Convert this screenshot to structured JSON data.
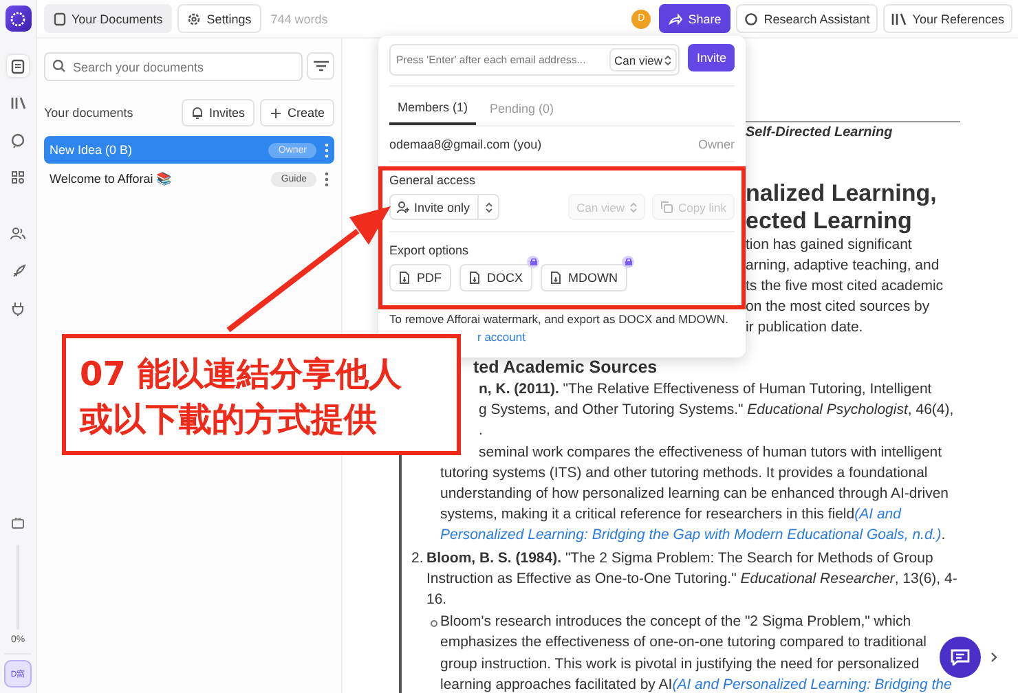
{
  "top_bar": {
    "tabs": [
      {
        "label": "Your Documents",
        "selected": true
      },
      {
        "label": "Settings",
        "selected": false
      }
    ],
    "word_count": "744 words",
    "avatar": "D",
    "share_button": "Share",
    "buttons": [
      "Research Assistant",
      "Your References"
    ]
  },
  "rail": {
    "zoom": {
      "level": 0,
      "reading": "0%"
    },
    "user_badge": "D窩"
  },
  "sidebar": {
    "search": {
      "placeholder": "Search your documents"
    },
    "heading": "Your documents",
    "invites_button": "Invites",
    "create_button": "Create",
    "documents": [
      {
        "title": "New Idea (0 B)",
        "badge": "Owner",
        "selected": true
      },
      {
        "title": "Welcome to Afforai 📚",
        "badge": "Guide",
        "selected": false
      }
    ]
  },
  "share_popup": {
    "email_field": {
      "placeholder": "Press 'Enter' after each email address..."
    },
    "role_select": "Can view",
    "invite_button": "Invite",
    "tabs": [
      {
        "label": "Members (1)",
        "selected": true
      },
      {
        "label": "Pending (0)",
        "selected": false
      }
    ],
    "members": [
      {
        "email": "odemaa8@gmail.com (you)",
        "role": "Owner"
      }
    ],
    "general_access": {
      "label": "General access",
      "access_select": "Invite only",
      "link_role": {
        "label": "Can view",
        "disabled": true
      },
      "copy_link": {
        "label": "Copy link",
        "disabled": true
      }
    },
    "export": {
      "label": "Export options",
      "buttons": [
        {
          "label": "PDF",
          "locked": false
        },
        {
          "label": "DOCX",
          "locked": true
        },
        {
          "label": "MDOWN",
          "locked": true
        }
      ]
    },
    "note": "To remove Afforai watermark, and export as DOCX and MDOWN.",
    "upgrade_link": "r account"
  },
  "document": {
    "top_lines": [
      {
        "kind": "subtitle",
        "text": "Self-Directed Learning"
      },
      {
        "kind": "heading",
        "text": "nalized Learning,"
      },
      {
        "kind": "heading",
        "text": "ected Learning"
      },
      {
        "kind": "body",
        "text": "tion has gained significant"
      },
      {
        "kind": "body",
        "text": "arning, adaptive teaching, and"
      },
      {
        "kind": "body",
        "text": "ts the five most cited academic"
      },
      {
        "kind": "body",
        "text": "on the most cited sources by"
      },
      {
        "kind": "body",
        "text": "ir publication date."
      }
    ],
    "lines": [
      {
        "kind": "heading",
        "parts": [
          {
            "kind": "text",
            "text": "ted Academic Sources"
          }
        ]
      },
      {
        "kind": "cut",
        "parts": [
          {
            "kind": "text",
            "text": "**n, K. (2011).** \"The Relative Effectiveness of Human Tutoring, Intelligent"
          }
        ]
      },
      {
        "kind": "cut",
        "parts": [
          {
            "kind": "text",
            "text": "g Systems, and Other Tutoring Systems.\" *Educational Psychologist*, 46(4),"
          }
        ]
      },
      {
        "kind": "cut",
        "parts": [
          {
            "kind": "text",
            "text": "."
          }
        ]
      },
      {
        "kind": "cut",
        "parts": [
          {
            "kind": "text",
            "text": "seminal work compares the effectiveness of human tutors with intelligent"
          }
        ]
      },
      {
        "kind": "sub",
        "parts": [
          {
            "kind": "text",
            "text": "tutoring systems (ITS) and other tutoring methods. It provides a foundational"
          }
        ]
      },
      {
        "kind": "sub",
        "parts": [
          {
            "kind": "text",
            "text": "understanding of how personalized learning can be enhanced through AI-driven"
          }
        ]
      },
      {
        "kind": "sub",
        "parts": [
          {
            "kind": "text",
            "text": "systems, making it a critical reference for researchers in this field"
          },
          {
            "kind": "link",
            "text": "(AI and"
          }
        ]
      },
      {
        "kind": "sub",
        "parts": [
          {
            "kind": "link",
            "text": "Personalized Learning: Bridging the Gap with Modern Educational Goals, n.d.)"
          },
          {
            "kind": "text",
            "text": "."
          }
        ]
      },
      {
        "kind": "item",
        "marker": "2.",
        "parts": [
          {
            "kind": "text",
            "text": "**Bloom, B. S. (1984).** \"The 2 Sigma Problem: The Search for Methods of Group"
          }
        ]
      },
      {
        "kind": "cont",
        "parts": [
          {
            "kind": "text",
            "text": "Instruction as Effective as One-to-One Tutoring.\" *Educational Researcher*, 13(6), 4-"
          }
        ]
      },
      {
        "kind": "cont",
        "parts": [
          {
            "kind": "text",
            "text": "16."
          }
        ]
      },
      {
        "kind": "bullet",
        "parts": [
          {
            "kind": "text",
            "text": "Bloom's research introduces the concept of the \"2 Sigma Problem,\" which"
          }
        ]
      },
      {
        "kind": "sub",
        "parts": [
          {
            "kind": "text",
            "text": "emphasizes the effectiveness of one-on-one tutoring compared to traditional"
          }
        ]
      },
      {
        "kind": "sub",
        "parts": [
          {
            "kind": "text",
            "text": "group instruction. This work is pivotal in justifying the need for personalized"
          }
        ]
      },
      {
        "kind": "sub",
        "parts": [
          {
            "kind": "text",
            "text": "learning approaches facilitated by AI"
          },
          {
            "kind": "link",
            "text": "(AI and Personalized Learning: Bridging the"
          }
        ]
      }
    ]
  },
  "annotation": {
    "callout_lines": [
      "07 能以連結分享他人",
      "或以下載的方式提供"
    ]
  }
}
